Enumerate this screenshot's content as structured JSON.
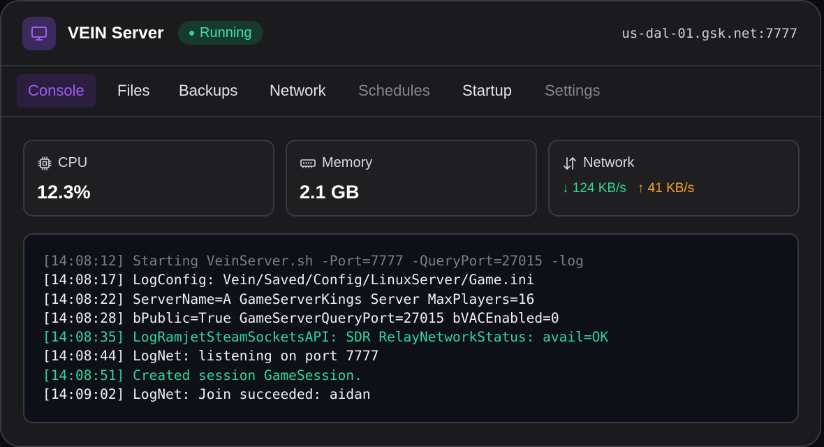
{
  "header": {
    "icon": "monitor-icon",
    "title": "VEIN Server",
    "status": "Running",
    "status_color": "#2fd69a",
    "address": "us-dal-01.gsk.net:7777"
  },
  "tabs": [
    {
      "label": "Console",
      "state": "active"
    },
    {
      "label": "Files",
      "state": "normal"
    },
    {
      "label": "Backups",
      "state": "normal"
    },
    {
      "label": "Network",
      "state": "normal"
    },
    {
      "label": "Schedules",
      "state": "disabled"
    },
    {
      "label": "Startup",
      "state": "normal"
    },
    {
      "label": "Settings",
      "state": "disabled"
    }
  ],
  "stats": {
    "cpu": {
      "label": "CPU",
      "icon": "cpu-icon",
      "value": "12.3%"
    },
    "memory": {
      "label": "Memory",
      "icon": "memory-icon",
      "value": "2.1 GB"
    },
    "network": {
      "label": "Network",
      "icon": "transfer-icon",
      "down": "↓ 124 KB/s",
      "up": "↑ 41 KB/s"
    }
  },
  "colors": {
    "accent": "#a35bf5",
    "success": "#2fd69a",
    "warning": "#f5a524"
  },
  "console": {
    "lines": [
      {
        "text": "[14:08:12] Starting VeinServer.sh -Port=7777 -QueryPort=27015 -log",
        "level": "dim"
      },
      {
        "text": "[14:08:17] LogConfig: Vein/Saved/Config/LinuxServer/Game.ini",
        "level": "normal"
      },
      {
        "text": "[14:08:22] ServerName=A GameServerKings Server MaxPlayers=16",
        "level": "normal"
      },
      {
        "text": "[14:08:28] bPublic=True GameServerQueryPort=27015 bVACEnabled=0",
        "level": "normal"
      },
      {
        "text": "[14:08:35] LogRamjetSteamSocketsAPI: SDR RelayNetworkStatus: avail=OK",
        "level": "ok"
      },
      {
        "text": "[14:08:44] LogNet: listening on port 7777",
        "level": "normal"
      },
      {
        "text": "[14:08:51] Created session GameSession.",
        "level": "ok"
      },
      {
        "text": "[14:09:02] LogNet: Join succeeded: aidan",
        "level": "normal"
      }
    ]
  }
}
